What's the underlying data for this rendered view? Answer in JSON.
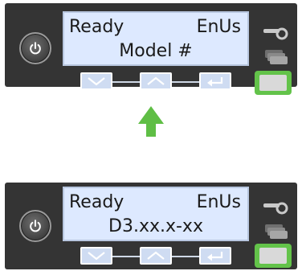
{
  "panels": [
    {
      "line1_left": "Ready",
      "line1_right": "EnUs",
      "line2": "Model #"
    },
    {
      "line1_left": "Ready",
      "line1_right": "EnUs",
      "line2": "D3.xx.x-xx"
    }
  ],
  "icons": {
    "power": "power-icon",
    "down": "chevron-down-icon",
    "up": "chevron-up-icon",
    "enter": "enter-icon",
    "ribbon": "ribbon-icon",
    "cards": "card-stack-icon",
    "indicator": "arrow-up-icon"
  },
  "colors": {
    "panel": "#343434",
    "lcd_background": "#dde9ff",
    "key_face": "#cfdcf2",
    "status_green": "#63c34a",
    "arrow_green": "#5fbe45"
  }
}
